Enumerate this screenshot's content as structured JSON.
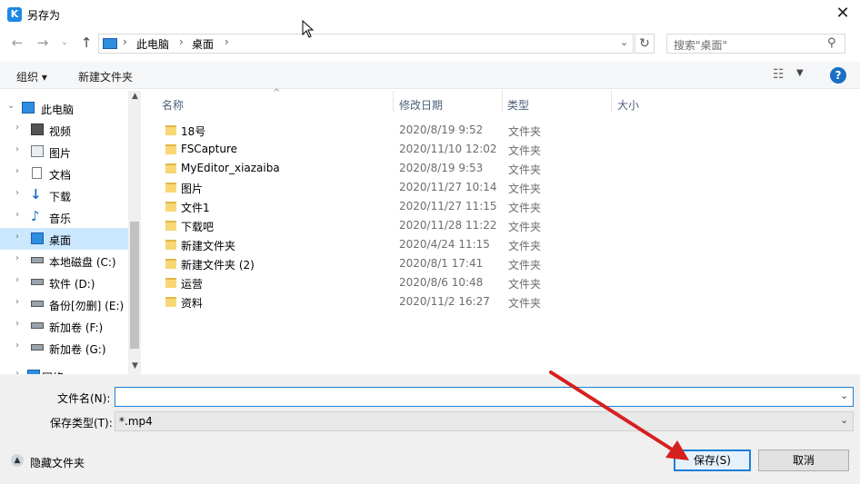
{
  "window": {
    "title": "另存为",
    "close_icon": "close-icon"
  },
  "address": {
    "crumbs": [
      "此电脑",
      "桌面"
    ]
  },
  "search": {
    "placeholder": "搜索\"桌面\""
  },
  "toolbar": {
    "organize": "组织 ▾",
    "new_folder": "新建文件夹"
  },
  "nav": {
    "items": [
      {
        "label": "此电脑",
        "icon": "pc-icon"
      },
      {
        "label": "视频",
        "icon": "video-icon"
      },
      {
        "label": "图片",
        "icon": "picture-icon"
      },
      {
        "label": "文档",
        "icon": "document-icon"
      },
      {
        "label": "下载",
        "icon": "download-icon"
      },
      {
        "label": "音乐",
        "icon": "music-icon"
      },
      {
        "label": "桌面",
        "icon": "desktop-icon",
        "selected": true
      },
      {
        "label": "本地磁盘 (C:)",
        "icon": "drive-icon"
      },
      {
        "label": "软件 (D:)",
        "icon": "drive-icon"
      },
      {
        "label": "备份[勿删] (E:)",
        "icon": "drive-icon"
      },
      {
        "label": "新加卷 (F:)",
        "icon": "drive-icon"
      },
      {
        "label": "新加卷 (G:)",
        "icon": "drive-icon"
      },
      {
        "label": "网络",
        "icon": "network-icon"
      }
    ]
  },
  "columns": {
    "name": "名称",
    "date": "修改日期",
    "type": "类型",
    "size": "大小"
  },
  "files": [
    {
      "name": "18号",
      "date": "2020/8/19 9:52",
      "type": "文件夹"
    },
    {
      "name": "FSCapture",
      "date": "2020/11/10 12:02",
      "type": "文件夹"
    },
    {
      "name": "MyEditor_xiazaiba",
      "date": "2020/8/19 9:53",
      "type": "文件夹"
    },
    {
      "name": "图片",
      "date": "2020/11/27 10:14",
      "type": "文件夹"
    },
    {
      "name": "文件1",
      "date": "2020/11/27 11:15",
      "type": "文件夹"
    },
    {
      "name": "下载吧",
      "date": "2020/11/28 11:22",
      "type": "文件夹"
    },
    {
      "name": "新建文件夹",
      "date": "2020/4/24 11:15",
      "type": "文件夹"
    },
    {
      "name": "新建文件夹 (2)",
      "date": "2020/8/1 17:41",
      "type": "文件夹"
    },
    {
      "name": "运营",
      "date": "2020/8/6 10:48",
      "type": "文件夹"
    },
    {
      "name": "资料",
      "date": "2020/11/2 16:27",
      "type": "文件夹"
    }
  ],
  "form": {
    "filename_label": "文件名(N):",
    "filename_value": "",
    "filetype_label": "保存类型(T):",
    "filetype_value": "*.mp4"
  },
  "footer": {
    "hide_folders": "隐藏文件夹",
    "save": "保存(S)",
    "cancel": "取消"
  },
  "colors": {
    "accent": "#1e7fd6",
    "selected": "#cce8ff",
    "annotation_arrow": "#d62020"
  }
}
